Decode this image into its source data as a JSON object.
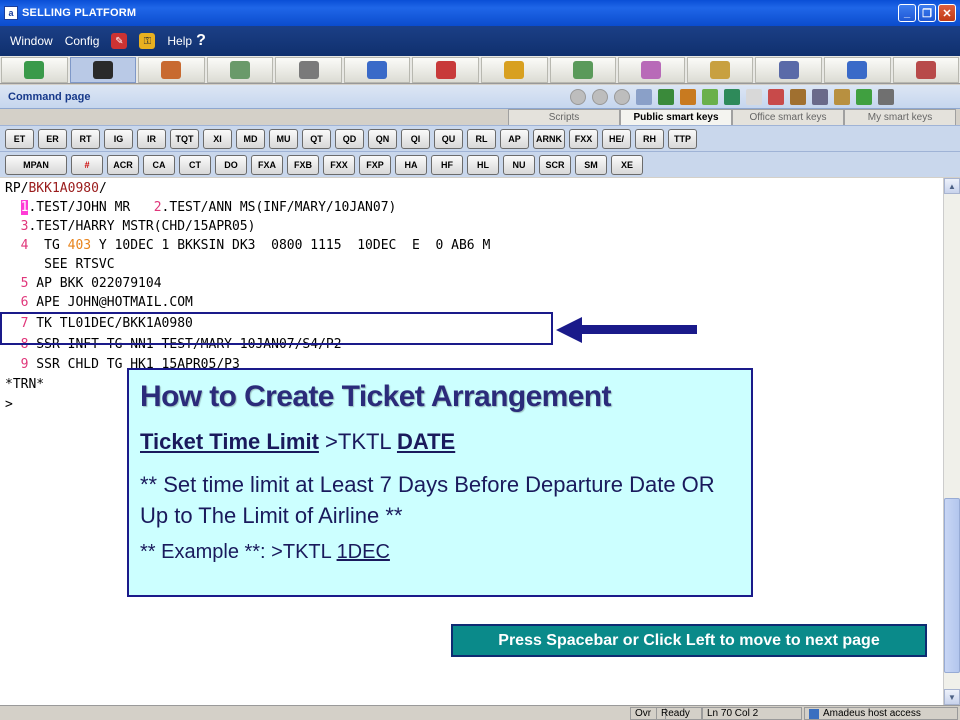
{
  "window": {
    "title": "SELLING PLATFORM"
  },
  "menu": {
    "items": [
      "Window",
      "Config",
      "Help"
    ]
  },
  "toolbar": {
    "icons": [
      "cube-icon",
      "terminal-icon",
      "agent-icon",
      "flight-icon",
      "gear-icon",
      "car-icon",
      "porter-icon",
      "umbrella-icon",
      "money-icon",
      "notes-icon",
      "wallet-icon",
      "pdf-icon",
      "info-icon",
      "stats-icon"
    ]
  },
  "command_page": {
    "title": "Command page"
  },
  "tabs": [
    "Scripts",
    "Public smart keys",
    "Office smart keys",
    "My smart keys"
  ],
  "keys_row1": [
    "ET",
    "ER",
    "RT",
    "IG",
    "IR",
    "TQT",
    "XI",
    "MD",
    "MU",
    "QT",
    "QD",
    "QN",
    "QI",
    "QU",
    "RL",
    "AP",
    "ARNK",
    "FXX",
    "HE/",
    "RH",
    "TTP"
  ],
  "keys_row2": [
    "MPAN",
    "#",
    "ACR",
    "CA",
    "CT",
    "DO",
    "FXA",
    "FXB",
    "FXX",
    "FXP",
    "HA",
    "HF",
    "HL",
    "NU",
    "SCR",
    "SM",
    "XE"
  ],
  "terminal": {
    "l0_a": "RP/",
    "l0_b": "BKK1A0980",
    "l0_c": "/",
    "l1_a": "1",
    "l1_b": ".TEST/JOHN MR   ",
    "l1_c": "2",
    "l1_d": ".TEST/ANN MS(INF/MARY/10JAN07)",
    "l2_a": "3",
    "l2_b": ".TEST/HARRY MSTR(CHD/15APR05)",
    "l3_a": "4",
    "l3_b": "  TG ",
    "l3_c": "403",
    "l3_d": " Y 10DEC 1 BKKSIN DK3  0800 1115  10DEC  E  0 AB6 M",
    "l4": "     SEE RTSVC",
    "l5_a": "5",
    "l5_b": " AP BKK 022079104",
    "l6_a": "6",
    "l6_b": " APE JOHN@HOTMAIL.COM",
    "l7_a": "7",
    "l7_b": " TK TL01DEC/BKK1A0980",
    "l8_a": "8",
    "l8_b": " SSR INFT TG NN1 TEST/MARY 10JAN07/S4/P2",
    "l9_a": "9",
    "l9_b": " SSR CHLD TG HK1 15APR05/P3",
    "l10": "*TRN*",
    "l11": ">"
  },
  "overlay": {
    "title": "How to Create Ticket Arrangement",
    "tl_label": "Ticket Time Limit",
    "tl_cmd": " >TKTL ",
    "tl_date": "DATE",
    "note": "** Set time limit at Least 7 Days Before Departure Date OR Up to The Limit of Airline **",
    "example_prefix": "** Example **: >TKTL ",
    "example_value": "1DEC"
  },
  "prompt": "Press Spacebar or Click Left to move to next page",
  "status": {
    "mode": "Ovr",
    "state": "Ready",
    "position": "Ln 70 Col 2",
    "host": "Amadeus host access"
  }
}
